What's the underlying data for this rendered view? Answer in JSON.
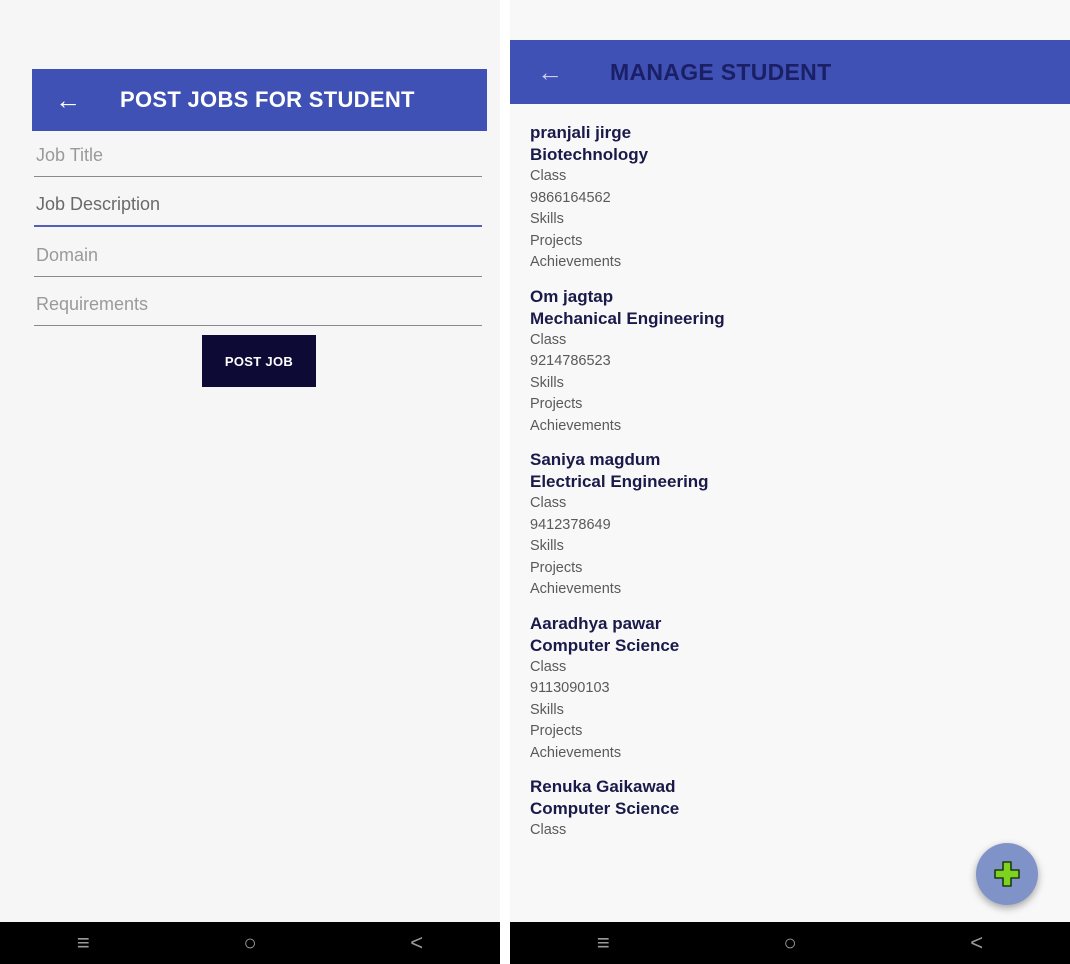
{
  "post_jobs": {
    "title": "POST JOBS FOR STUDENT",
    "back_glyph": "←",
    "fields": [
      {
        "placeholder": "Job Title",
        "value": ""
      },
      {
        "placeholder": "Job Description",
        "value": ""
      },
      {
        "placeholder": "Domain",
        "value": ""
      },
      {
        "placeholder": "Requirements",
        "value": ""
      }
    ],
    "post_button_label": "POST JOB"
  },
  "manage_student": {
    "title": "MANAGE STUDENT",
    "back_glyph": "←",
    "students": [
      {
        "name": "pranjali jirge",
        "branch": "Biotechnology",
        "class": "Class",
        "phone": "9866164562",
        "skills": "Skills",
        "projects": "Projects",
        "achievements": "Achievements"
      },
      {
        "name": "Om jagtap",
        "branch": "Mechanical Engineering",
        "class": "Class",
        "phone": "9214786523",
        "skills": "Skills",
        "projects": "Projects",
        "achievements": "Achievements"
      },
      {
        "name": "Saniya magdum",
        "branch": "Electrical Engineering",
        "class": "Class",
        "phone": "9412378649",
        "skills": "Skills",
        "projects": "Projects",
        "achievements": "Achievements"
      },
      {
        "name": "Aaradhya pawar",
        "branch": "Computer Science",
        "class": "Class",
        "phone": "9113090103",
        "skills": "Skills",
        "projects": "Projects",
        "achievements": "Achievements"
      },
      {
        "name": "Renuka Gaikawad",
        "branch": "Computer Science",
        "class": "Class"
      }
    ],
    "fab_icon": "plus-icon"
  },
  "nav": {
    "menu_glyph": "≡",
    "home_glyph": "○",
    "back_glyph": "<"
  },
  "colors": {
    "app_bar": "#3f51b5",
    "button": "#0d0b35",
    "fab": "#8093c9",
    "fab_plus": "#7ed321",
    "nav_bar": "#000000"
  }
}
